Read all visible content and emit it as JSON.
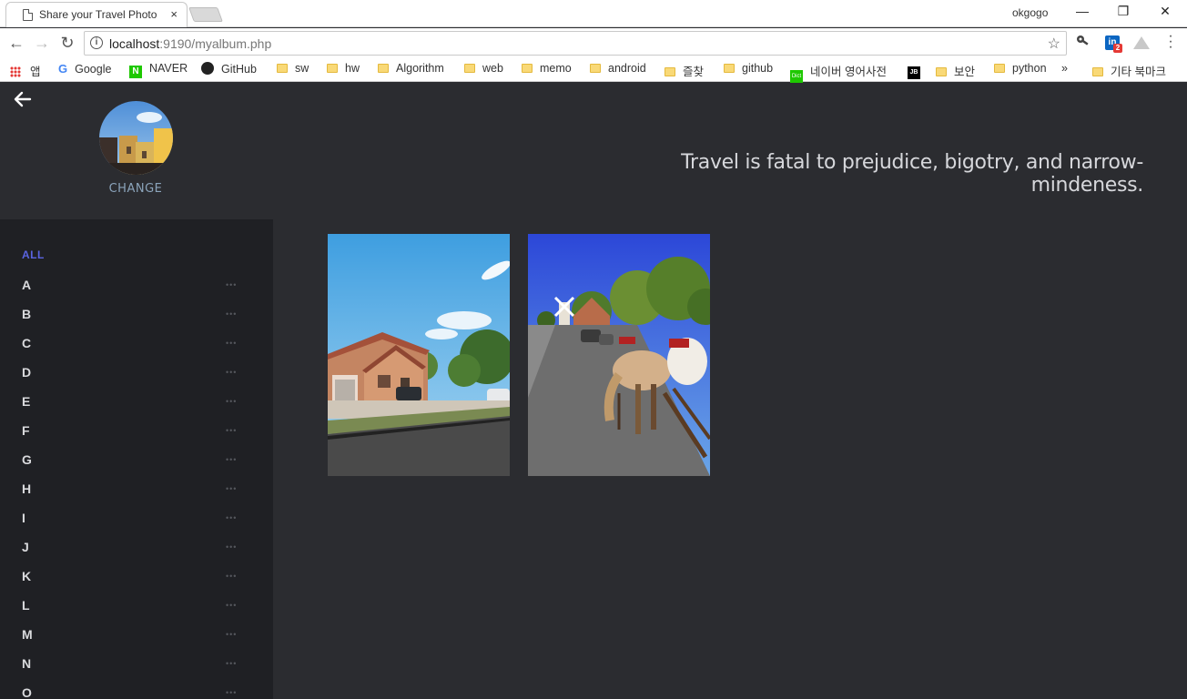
{
  "browser": {
    "tab_title": "Share your Travel Photo",
    "tab_close": "×",
    "profile_name": "okgogo",
    "window_minimize": "—",
    "window_restore": "❐",
    "window_close": "✕",
    "back": "←",
    "forward": "→",
    "reload": "↻",
    "url_host": "localhost",
    "url_path": ":9190/myalbum.php",
    "bookmark_star": "☆",
    "linkedin_badge": "2",
    "bookmarks_more": "»",
    "bookmarks": [
      {
        "label": "앱"
      },
      {
        "label": "Google"
      },
      {
        "label": "NAVER"
      },
      {
        "label": "GitHub"
      },
      {
        "label": "sw"
      },
      {
        "label": "hw"
      },
      {
        "label": "Algorithm"
      },
      {
        "label": "web"
      },
      {
        "label": "memo"
      },
      {
        "label": "android"
      },
      {
        "label": "즐찾"
      },
      {
        "label": "github"
      },
      {
        "label": "네이버 영어사전"
      },
      {
        "label": ""
      },
      {
        "label": "보안"
      },
      {
        "label": "python"
      },
      {
        "label": "기타 북마크"
      }
    ]
  },
  "page": {
    "change_label": "CHANGE",
    "quote": "Travel is fatal to prejudice, bigotry, and narrow-mindeness.",
    "sidebar": {
      "all_label": "ALL",
      "items": [
        "A",
        "B",
        "C",
        "D",
        "E",
        "F",
        "G",
        "H",
        "I",
        "J",
        "K",
        "L",
        "M",
        "N",
        "O"
      ],
      "dots": "•••"
    },
    "photos": [
      {
        "subject": "suburban street with houses"
      },
      {
        "subject": "horse carriage on street"
      }
    ]
  },
  "colors": {
    "page_bg": "#2b2c30",
    "sidebar_bg": "#1f2024",
    "accent": "#5a64e0",
    "quote_text": "#d6d7db"
  }
}
